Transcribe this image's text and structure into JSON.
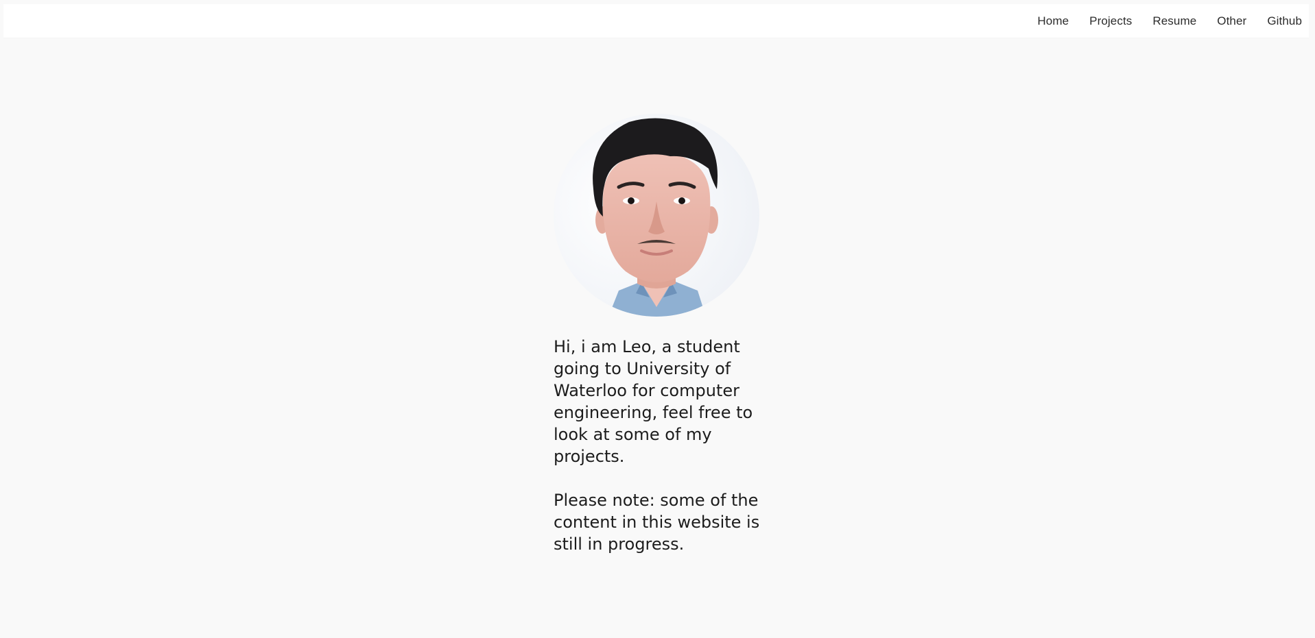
{
  "nav": {
    "items": [
      {
        "label": "Home"
      },
      {
        "label": "Projects"
      },
      {
        "label": "Resume"
      },
      {
        "label": "Other"
      },
      {
        "label": "Github"
      }
    ]
  },
  "profile": {
    "intro": "Hi, i am Leo, a student going to University of Waterloo for computer engineering, feel free to look at some of my projects.",
    "note": "Please note: some of the content in this website is still in progress."
  },
  "colors": {
    "page_background": "#f9f9f9",
    "navbar_background": "#ffffff",
    "text": "#1c1c1c"
  },
  "icons": {
    "avatar": "profile-photo-icon"
  }
}
